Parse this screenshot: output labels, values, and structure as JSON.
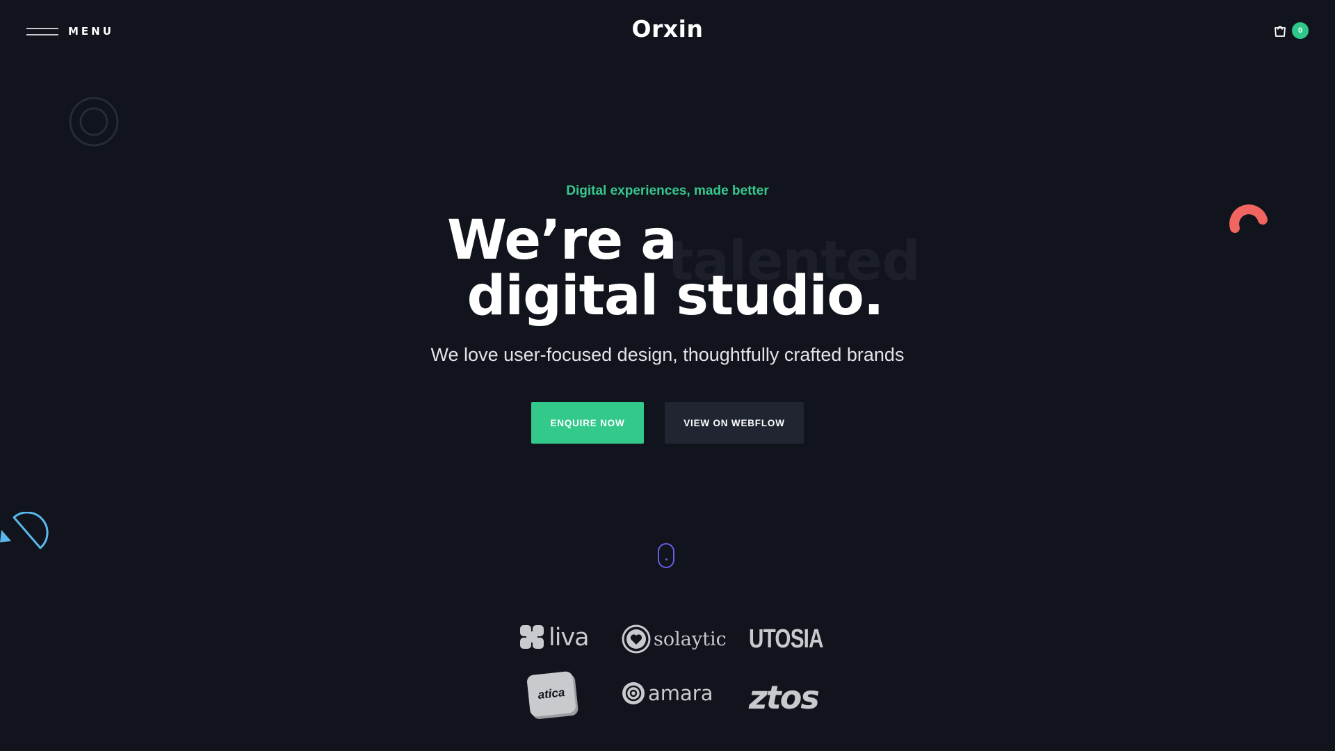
{
  "header": {
    "menu_label": "MENU",
    "logo": "Orxin",
    "cart_count": "0"
  },
  "hero": {
    "eyebrow": "Digital experiences, made better",
    "headline_line1": "We’re a",
    "headline_ghost": "talented",
    "headline_line2": "digital studio.",
    "subtitle": "We love user-focused design, thoughtfully crafted brands",
    "primary_button": "ENQUIRE NOW",
    "secondary_button": "VIEW ON WEBFLOW"
  },
  "clients": {
    "liva": "liva",
    "solaytic": "solaytic",
    "utosia": "UTOSIA",
    "atica": "atica",
    "amara": "amara",
    "ztos": "ztos"
  },
  "colors": {
    "background": "#11141c",
    "accent_green": "#32c98b",
    "secondary_button": "#212531",
    "coral": "#f0655f",
    "sky_blue": "#5ab8ec",
    "violet": "#6b5ce7"
  },
  "icons": {
    "menu": "hamburger-icon",
    "cart": "shopping-bag-icon",
    "scroll": "mouse-scroll-icon"
  }
}
